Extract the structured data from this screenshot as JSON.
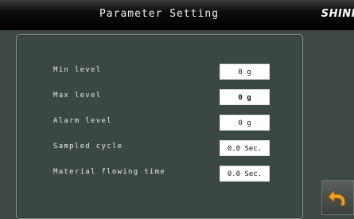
{
  "header": {
    "title": "Parameter Setting",
    "brand": "SHINI"
  },
  "parameters": [
    {
      "label": "Min level",
      "value": "0 g"
    },
    {
      "label": "Max level",
      "value": "0 g"
    },
    {
      "label": "Alarm level",
      "value": "0 g"
    },
    {
      "label": "Sampled cycle",
      "value": "0.0 Sec."
    },
    {
      "label": "Material flowing time",
      "value": "0.0 Sec."
    }
  ],
  "icons": {
    "back": "back-arrow-icon"
  },
  "colors": {
    "background": "#3e4943",
    "titlebar": "#000000",
    "field": "#ffffff",
    "back_arrow": "#f0a020"
  }
}
